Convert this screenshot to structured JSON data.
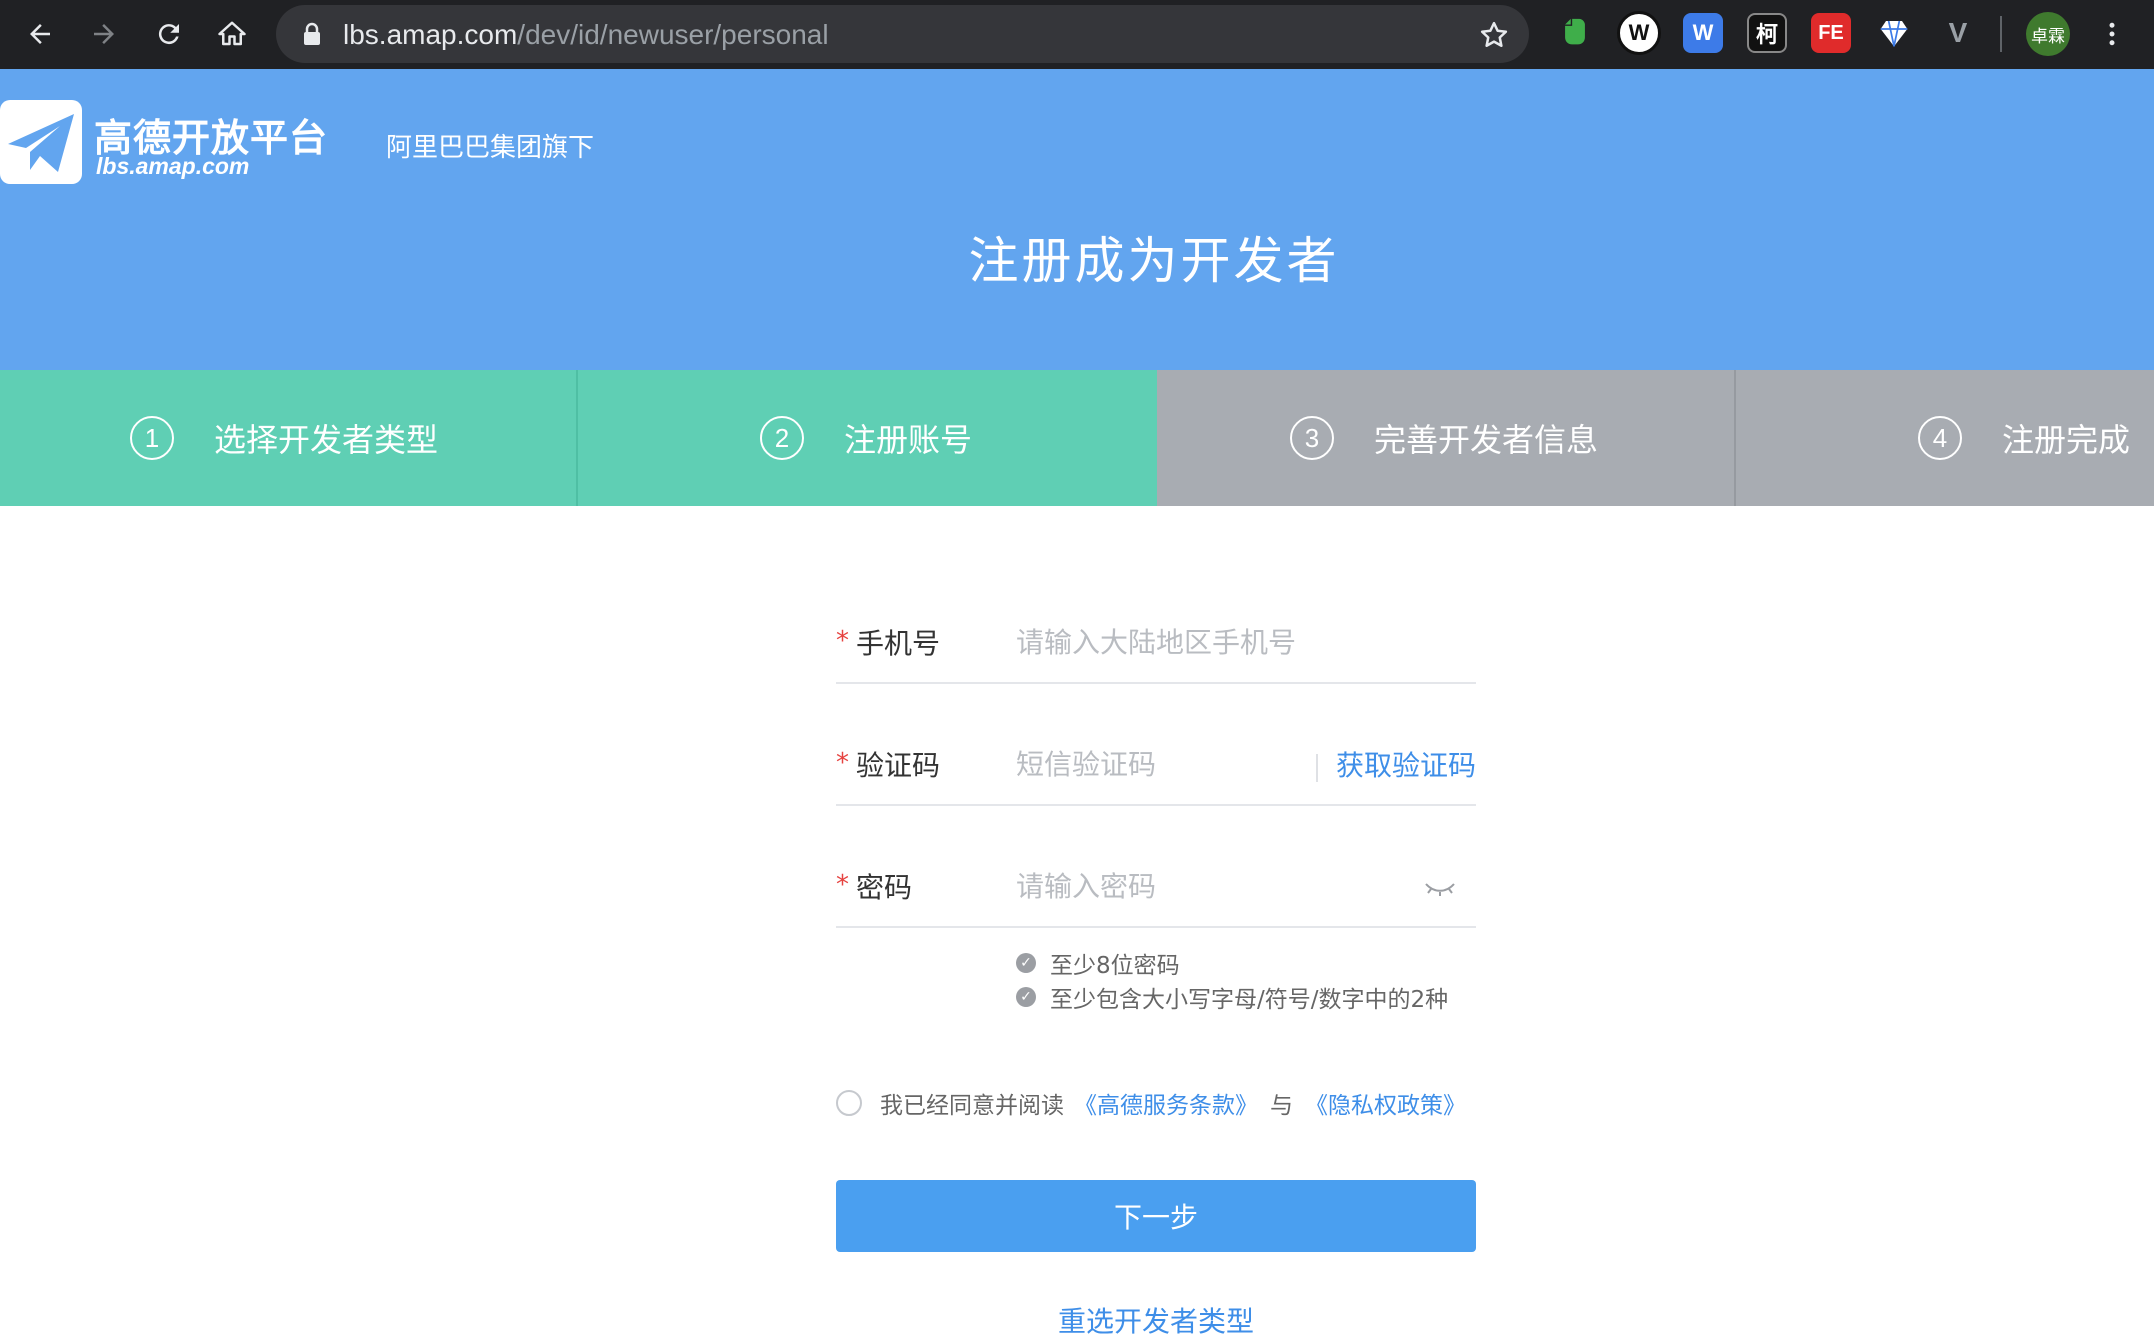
{
  "browser": {
    "url_host": "lbs.amap.com",
    "url_path": "/dev/id/newuser/personal",
    "profile_name": "卓霖",
    "extensions": [
      {
        "name": "evernote-icon",
        "label": "",
        "color": "#3fae4a"
      },
      {
        "name": "wappalyzer-icon",
        "label": "W",
        "color": "#ffffff"
      },
      {
        "name": "w-extension-icon",
        "label": "W",
        "color": "#3d7be8"
      },
      {
        "name": "ke-extension-icon",
        "label": "柯",
        "color": "#111111"
      },
      {
        "name": "fe-helper-icon",
        "label": "FE",
        "color": "#e02b2b"
      },
      {
        "name": "diamond-extension-icon",
        "label": "",
        "color": "#ffffff"
      },
      {
        "name": "vue-devtools-icon",
        "label": "V",
        "color": "#9aa0a6"
      }
    ]
  },
  "header": {
    "logo_title": "高德开放平台",
    "logo_domain": "lbs.amap.com",
    "subtitle": "阿里巴巴集团旗下",
    "page_title": "注册成为开发者",
    "brand_color": "#62a5ef"
  },
  "steps": [
    {
      "number": "1",
      "label": "选择开发者类型",
      "status": "done"
    },
    {
      "number": "2",
      "label": "注册账号",
      "status": "current"
    },
    {
      "number": "3",
      "label": "完善开发者信息",
      "status": "pending"
    },
    {
      "number": "4",
      "label": "注册完成",
      "status": "pending"
    }
  ],
  "form": {
    "required_mark": "*",
    "phone": {
      "label": "手机号",
      "placeholder": "请输入大陆地区手机号",
      "value": ""
    },
    "code": {
      "label": "验证码",
      "placeholder": "短信验证码",
      "value": "",
      "action": "获取验证码"
    },
    "password": {
      "label": "密码",
      "placeholder": "请输入密码",
      "value": ""
    },
    "password_rules": [
      "至少8位密码",
      "至少包含大小写字母/符号/数字中的2种"
    ],
    "agreement": {
      "prefix": "我已经同意并阅读",
      "terms": "《高德服务条款》",
      "conjunction": "与",
      "privacy": "《隐私权政策》",
      "checked": false
    },
    "next_button": "下一步",
    "reselect_link": "重选开发者类型"
  },
  "colors": {
    "step_done": "#5fcfb4",
    "step_pending": "#a8acb2",
    "primary_button": "#4a9ff0",
    "link": "#3e8ee8",
    "required": "#e64340"
  }
}
